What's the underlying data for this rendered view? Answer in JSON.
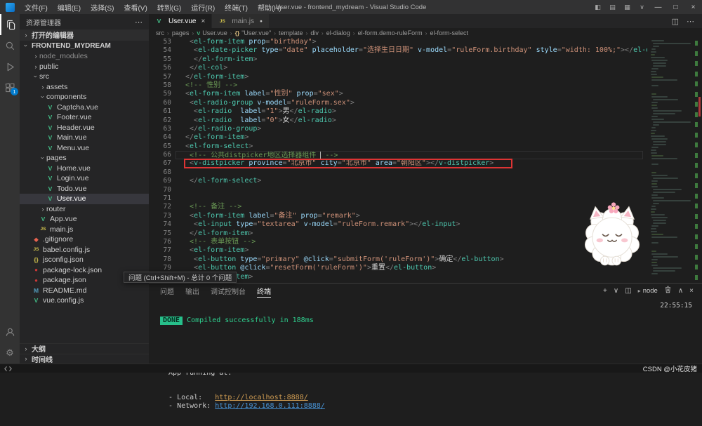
{
  "title_bar": {
    "menus": [
      "文件(F)",
      "编辑(E)",
      "选择(S)",
      "查看(V)",
      "转到(G)",
      "运行(R)",
      "终端(T)",
      "帮助(H)"
    ],
    "title": "User.vue - frontend_mydream - Visual Studio Code"
  },
  "activity_bar": {
    "extensions_badge": "1"
  },
  "sidebar": {
    "title": "资源管理器",
    "sections": {
      "open_editors": "打开的编辑器",
      "outline": "大纲",
      "timeline": "时间线"
    },
    "root": "FRONTEND_MYDREAM",
    "tree": [
      {
        "label": "node_modules",
        "depth": 1,
        "type": "folder",
        "chev": "right",
        "dim": true
      },
      {
        "label": "public",
        "depth": 1,
        "type": "folder",
        "chev": "right"
      },
      {
        "label": "src",
        "depth": 1,
        "type": "folder",
        "chev": "down"
      },
      {
        "label": "assets",
        "depth": 2,
        "type": "folder",
        "chev": "right"
      },
      {
        "label": "components",
        "depth": 2,
        "type": "folder",
        "chev": "down"
      },
      {
        "label": "Captcha.vue",
        "depth": 3,
        "type": "vue"
      },
      {
        "label": "Footer.vue",
        "depth": 3,
        "type": "vue"
      },
      {
        "label": "Header.vue",
        "depth": 3,
        "type": "vue"
      },
      {
        "label": "Main.vue",
        "depth": 3,
        "type": "vue"
      },
      {
        "label": "Menu.vue",
        "depth": 3,
        "type": "vue"
      },
      {
        "label": "pages",
        "depth": 2,
        "type": "folder",
        "chev": "down"
      },
      {
        "label": "Home.vue",
        "depth": 3,
        "type": "vue"
      },
      {
        "label": "Login.vue",
        "depth": 3,
        "type": "vue"
      },
      {
        "label": "Todo.vue",
        "depth": 3,
        "type": "vue"
      },
      {
        "label": "User.vue",
        "depth": 3,
        "type": "vue",
        "selected": true
      },
      {
        "label": "router",
        "depth": 2,
        "type": "folder",
        "chev": "right"
      },
      {
        "label": "App.vue",
        "depth": 2,
        "type": "vue"
      },
      {
        "label": "main.js",
        "depth": 2,
        "type": "js"
      },
      {
        "label": ".gitignore",
        "depth": 1,
        "type": "git"
      },
      {
        "label": "babel.config.js",
        "depth": 1,
        "type": "js"
      },
      {
        "label": "jsconfig.json",
        "depth": 1,
        "type": "json"
      },
      {
        "label": "package-lock.json",
        "depth": 1,
        "type": "npm"
      },
      {
        "label": "package.json",
        "depth": 1,
        "type": "npm"
      },
      {
        "label": "README.md",
        "depth": 1,
        "type": "md"
      },
      {
        "label": "vue.config.js",
        "depth": 1,
        "type": "vue"
      }
    ]
  },
  "editor": {
    "tabs": [
      {
        "label": "User.vue",
        "active": true
      },
      {
        "label": "main.js",
        "active": false,
        "modified": true
      }
    ],
    "breadcrumbs": [
      {
        "label": "src"
      },
      {
        "label": "pages"
      },
      {
        "label": "User.vue",
        "icon": "vue"
      },
      {
        "label": "\"User.vue\"",
        "icon": "symbol"
      },
      {
        "label": "template"
      },
      {
        "label": "div"
      },
      {
        "label": "el-dialog"
      },
      {
        "label": "el-form.demo-ruleForm"
      },
      {
        "label": "el-form-select"
      }
    ],
    "code": [
      {
        "n": 53,
        "tk": [
          [
            "p",
            "  <"
          ],
          [
            "t",
            "el-form-item"
          ],
          [
            "a",
            " prop"
          ],
          [
            "p",
            "="
          ],
          [
            "s",
            "\"birthday\""
          ],
          [
            "p",
            ">"
          ]
        ]
      },
      {
        "n": 54,
        "tk": [
          [
            "p",
            "   <"
          ],
          [
            "t",
            "el-date-picker"
          ],
          [
            "a",
            " type"
          ],
          [
            "p",
            "="
          ],
          [
            "s",
            "\"date\""
          ],
          [
            "a",
            " placeholder"
          ],
          [
            "p",
            "="
          ],
          [
            "s",
            "\"选择生日日期\""
          ],
          [
            "a",
            " v-model"
          ],
          [
            "p",
            "="
          ],
          [
            "s",
            "\"ruleForm.birthday\""
          ],
          [
            "a",
            " style"
          ],
          [
            "p",
            "="
          ],
          [
            "s",
            "\"width: 100%;\""
          ],
          [
            "p",
            "></"
          ],
          [
            "t",
            "el-date-picker"
          ],
          [
            "p",
            ">"
          ]
        ]
      },
      {
        "n": 55,
        "tk": [
          [
            "p",
            "   </"
          ],
          [
            "t",
            "el-form-item"
          ],
          [
            "p",
            ">"
          ]
        ]
      },
      {
        "n": 56,
        "tk": [
          [
            "p",
            "  </"
          ],
          [
            "t",
            "el-col"
          ],
          [
            "p",
            ">"
          ]
        ]
      },
      {
        "n": 57,
        "tk": [
          [
            "p",
            " </"
          ],
          [
            "t",
            "el-form-item"
          ],
          [
            "p",
            ">"
          ]
        ]
      },
      {
        "n": 58,
        "tk": [
          [
            "c",
            " <!-- 性别 -->"
          ]
        ]
      },
      {
        "n": 59,
        "tk": [
          [
            "p",
            " <"
          ],
          [
            "t",
            "el-form-item"
          ],
          [
            "a",
            " label"
          ],
          [
            "p",
            "="
          ],
          [
            "s",
            "\"性别\""
          ],
          [
            "a",
            " prop"
          ],
          [
            "p",
            "="
          ],
          [
            "s",
            "\"sex\""
          ],
          [
            "p",
            ">"
          ]
        ]
      },
      {
        "n": 60,
        "tk": [
          [
            "p",
            "  <"
          ],
          [
            "t",
            "el-radio-group"
          ],
          [
            "a",
            " v-model"
          ],
          [
            "p",
            "="
          ],
          [
            "s",
            "\"ruleForm.sex\""
          ],
          [
            "p",
            ">"
          ]
        ]
      },
      {
        "n": 61,
        "tk": [
          [
            "p",
            "   <"
          ],
          [
            "t",
            "el-radio"
          ],
          [
            "a",
            "  label"
          ],
          [
            "p",
            "="
          ],
          [
            "s",
            "\"1\""
          ],
          [
            "p",
            ">"
          ],
          [
            "x",
            "男"
          ],
          [
            "p",
            "</"
          ],
          [
            "t",
            "el-radio"
          ],
          [
            "p",
            ">"
          ]
        ]
      },
      {
        "n": 62,
        "tk": [
          [
            "p",
            "   <"
          ],
          [
            "t",
            "el-radio"
          ],
          [
            "a",
            "  label"
          ],
          [
            "p",
            "="
          ],
          [
            "s",
            "\"0\""
          ],
          [
            "p",
            ">"
          ],
          [
            "x",
            "女"
          ],
          [
            "p",
            "</"
          ],
          [
            "t",
            "el-radio"
          ],
          [
            "p",
            ">"
          ]
        ]
      },
      {
        "n": 63,
        "tk": [
          [
            "p",
            "  </"
          ],
          [
            "t",
            "el-radio-group"
          ],
          [
            "p",
            ">"
          ]
        ]
      },
      {
        "n": 64,
        "tk": [
          [
            "p",
            " </"
          ],
          [
            "t",
            "el-form-item"
          ],
          [
            "p",
            ">"
          ]
        ]
      },
      {
        "n": 65,
        "tk": [
          [
            "p",
            " <"
          ],
          [
            "t",
            "el-form-select"
          ],
          [
            "p",
            ">"
          ]
        ]
      },
      {
        "n": 66,
        "current": true,
        "tk": [
          [
            "c",
            "  <!-- 公共distpicker地区选择器组件 "
          ],
          [
            "cur",
            ""
          ],
          [
            "c",
            " -->"
          ]
        ]
      },
      {
        "n": 67,
        "boxed": true,
        "tk": [
          [
            "p",
            "  <"
          ],
          [
            "t",
            "v-distpicker"
          ],
          [
            "a",
            " province"
          ],
          [
            "p",
            "="
          ],
          [
            "s",
            "\"北京市\""
          ],
          [
            "a",
            " city"
          ],
          [
            "p",
            "="
          ],
          [
            "s",
            "\"北京市\""
          ],
          [
            "a",
            " area"
          ],
          [
            "p",
            "="
          ],
          [
            "s",
            "\"朝阳区\""
          ],
          [
            "p",
            "></"
          ],
          [
            "t",
            "v-distpicker"
          ],
          [
            "p",
            ">"
          ]
        ]
      },
      {
        "n": 68,
        "tk": []
      },
      {
        "n": 69,
        "tk": [
          [
            "p",
            "  </"
          ],
          [
            "t",
            "el-form-select"
          ],
          [
            "p",
            ">"
          ]
        ]
      },
      {
        "n": 70,
        "tk": []
      },
      {
        "n": 71,
        "tk": []
      },
      {
        "n": 72,
        "tk": [
          [
            "c",
            "  <!-- 备注 -->"
          ]
        ]
      },
      {
        "n": 73,
        "tk": [
          [
            "p",
            "  <"
          ],
          [
            "t",
            "el-form-item"
          ],
          [
            "a",
            " label"
          ],
          [
            "p",
            "="
          ],
          [
            "s",
            "\"备注\""
          ],
          [
            "a",
            " prop"
          ],
          [
            "p",
            "="
          ],
          [
            "s",
            "\"remark\""
          ],
          [
            "p",
            ">"
          ]
        ]
      },
      {
        "n": 74,
        "tk": [
          [
            "p",
            "   <"
          ],
          [
            "t",
            "el-input"
          ],
          [
            "a",
            " type"
          ],
          [
            "p",
            "="
          ],
          [
            "s",
            "\"textarea\""
          ],
          [
            "a",
            " v-model"
          ],
          [
            "p",
            "="
          ],
          [
            "s",
            "\"ruleForm.remark\""
          ],
          [
            "p",
            "></"
          ],
          [
            "t",
            "el-input"
          ],
          [
            "p",
            ">"
          ]
        ]
      },
      {
        "n": 75,
        "tk": [
          [
            "p",
            "  </"
          ],
          [
            "t",
            "el-form-item"
          ],
          [
            "p",
            ">"
          ]
        ]
      },
      {
        "n": 76,
        "tk": [
          [
            "c",
            "  <!-- 表单按钮 -->"
          ]
        ]
      },
      {
        "n": 77,
        "tk": [
          [
            "p",
            "  <"
          ],
          [
            "t",
            "el-form-item"
          ],
          [
            "p",
            ">"
          ]
        ]
      },
      {
        "n": 78,
        "tk": [
          [
            "p",
            "   <"
          ],
          [
            "t",
            "el-button"
          ],
          [
            "a",
            " type"
          ],
          [
            "p",
            "="
          ],
          [
            "s",
            "\"primary\""
          ],
          [
            "a",
            " @click"
          ],
          [
            "p",
            "="
          ],
          [
            "s",
            "\"submitForm('ruleForm')\""
          ],
          [
            "p",
            ">"
          ],
          [
            "x",
            "确定"
          ],
          [
            "p",
            "</"
          ],
          [
            "t",
            "el-button"
          ],
          [
            "p",
            ">"
          ]
        ]
      },
      {
        "n": 79,
        "tk": [
          [
            "p",
            "   <"
          ],
          [
            "t",
            "el-button"
          ],
          [
            "a",
            " @click"
          ],
          [
            "p",
            "="
          ],
          [
            "s",
            "\"resetForm('ruleForm')\""
          ],
          [
            "p",
            ">"
          ],
          [
            "x",
            "重置"
          ],
          [
            "p",
            "</"
          ],
          [
            "t",
            "el-button"
          ],
          [
            "p",
            ">"
          ]
        ]
      },
      {
        "n": 80,
        "tk": [
          [
            "p",
            "  </"
          ],
          [
            "t",
            "el-form-item"
          ],
          [
            "p",
            ">"
          ]
        ]
      }
    ]
  },
  "tooltip": "问题 (Ctrl+Shift+M) - 总计 0 个问题",
  "panel": {
    "tabs": [
      {
        "label": "问题",
        "active": false
      },
      {
        "label": "输出",
        "active": false
      },
      {
        "label": "调试控制台",
        "active": false
      },
      {
        "label": "终端",
        "active": true
      }
    ],
    "shell_label": "node",
    "clock": "22:55:15",
    "terminal": {
      "badge": "DONE",
      "compile_message": " Compiled successfully in 188ms",
      "running_title": "  App running at:",
      "links": [
        {
          "label": "  - Local:   ",
          "url": "http://localhost:8888/",
          "kind": "local"
        },
        {
          "label": "  - Network: ",
          "url": "http://192.168.0.111:8888/",
          "kind": "network"
        }
      ]
    }
  },
  "status_bar": {
    "watermark": "CSDN @小花皮猪"
  },
  "icons": {
    "more": "⋯",
    "split_editor": "◫",
    "layout_sidebar": "◧",
    "layout_panel": "▤",
    "layout_grid": "▦",
    "customize": "∨",
    "minimize": "—",
    "maximize": "□",
    "close": "×",
    "plus": "+",
    "chevron_down": "∨",
    "chevron_up": "∧",
    "folder_chevron": "›",
    "breadcrumb_separator": "›",
    "modified_dot": "●",
    "shell_prompt": "▸",
    "settings": "⚙",
    "vue_glyph": "V",
    "js_glyph": "JS",
    "json_glyph": "{}",
    "npm_glyph": "●",
    "git_glyph": "◆",
    "md_glyph": "M",
    "symbol_glyph": "{}"
  },
  "colors": {
    "accent_blue": "#007acc",
    "tag_teal": "#4ec9b0",
    "attr_blue": "#9cdcfe",
    "string_orange": "#ce9178",
    "comment_green": "#6a9955",
    "done_green": "#27c08b",
    "annotation_red": "#dd3434"
  }
}
